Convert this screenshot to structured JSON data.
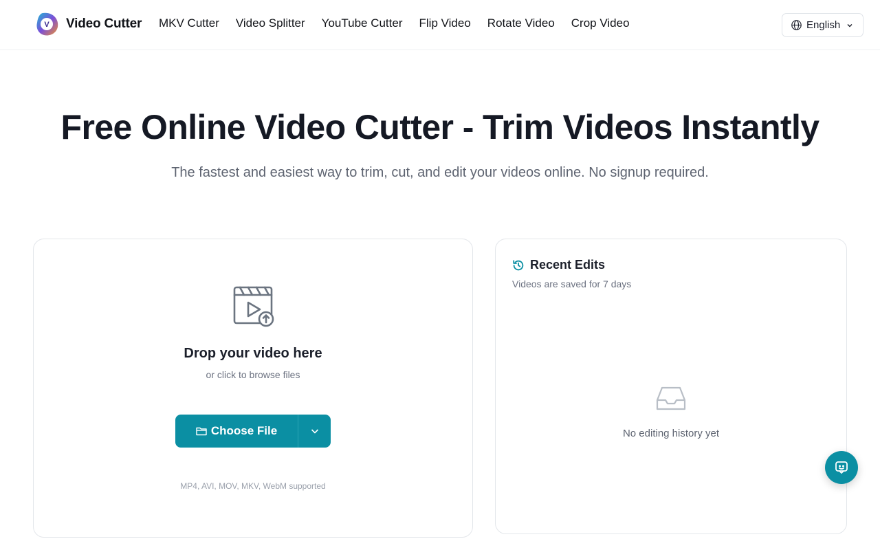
{
  "header": {
    "brand": "Video Cutter",
    "nav": [
      {
        "label": "MKV Cutter"
      },
      {
        "label": "Video Splitter"
      },
      {
        "label": "YouTube Cutter"
      },
      {
        "label": "Flip Video"
      },
      {
        "label": "Rotate Video"
      },
      {
        "label": "Crop Video"
      }
    ],
    "language": "English"
  },
  "hero": {
    "title": "Free Online Video Cutter - Trim Videos Instantly",
    "subtitle": "The fastest and easiest way to trim, cut, and edit your videos online. No signup required."
  },
  "upload": {
    "title": "Drop your video here",
    "subtitle": "or click to browse files",
    "button_label": "Choose File",
    "formats": "MP4, AVI, MOV, MKV, WebM supported"
  },
  "recent": {
    "title": "Recent Edits",
    "subtitle": "Videos are saved for 7 days",
    "empty": "No editing history yet"
  },
  "icons": {
    "logo": "video-cutter-logo",
    "language": "globe-icon",
    "upload": "clapperboard-upload-icon",
    "folder": "folder-icon",
    "dropdown": "chevron-down-icon",
    "history": "history-icon",
    "empty": "inbox-icon",
    "chat": "chat-icon"
  },
  "colors": {
    "accent": "#0b8fa3",
    "text": "#151924",
    "muted": "#6b7180"
  }
}
